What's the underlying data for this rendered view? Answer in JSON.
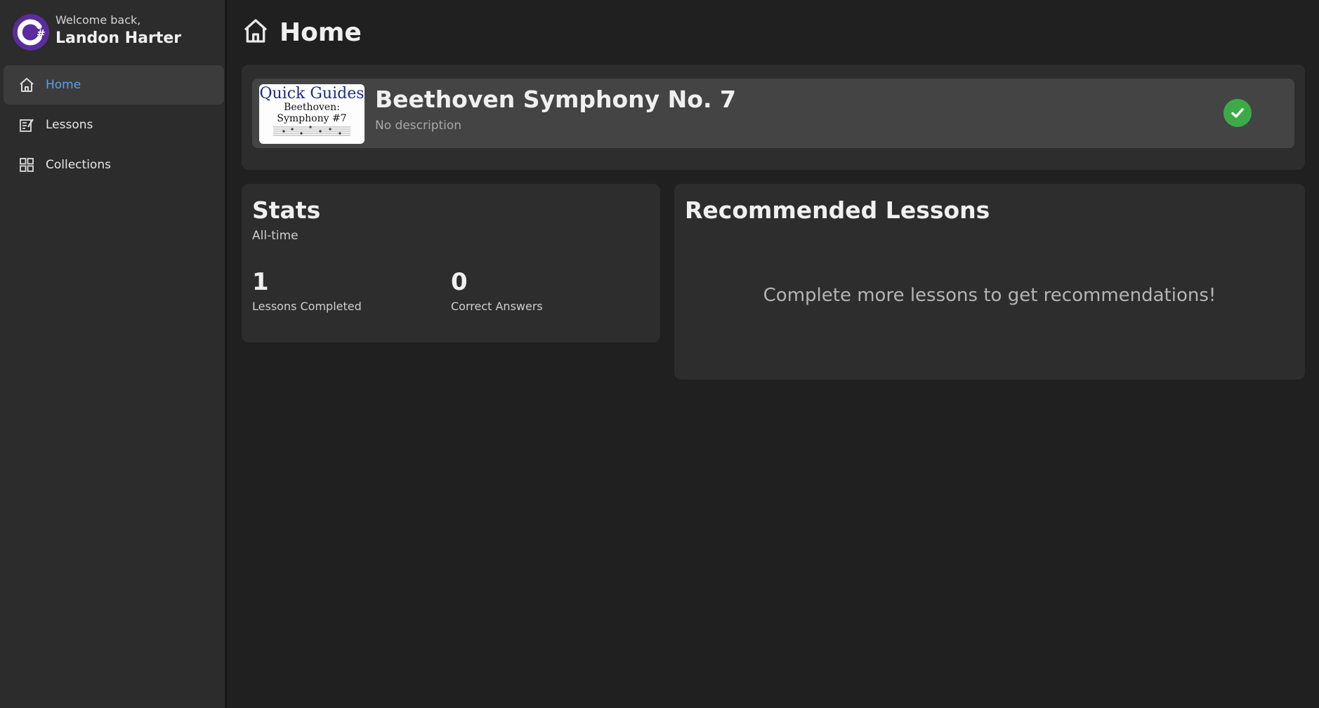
{
  "sidebar": {
    "welcome": "Welcome back,",
    "username": "Landon Harter",
    "items": [
      {
        "label": "Home",
        "icon": "home-icon",
        "active": true
      },
      {
        "label": "Lessons",
        "icon": "lessons-icon",
        "active": false
      },
      {
        "label": "Collections",
        "icon": "grid-icon",
        "active": false
      }
    ]
  },
  "header": {
    "title": "Home"
  },
  "featured": {
    "thumbnail": {
      "line1": "Quick Guides",
      "line2": "Beethoven:",
      "line3": "Symphony #7"
    },
    "title": "Beethoven Symphony No. 7",
    "description": "No description",
    "completed": true
  },
  "stats": {
    "title": "Stats",
    "subtitle": "All-time",
    "items": [
      {
        "value": "1",
        "label": "Lessons Completed"
      },
      {
        "value": "0",
        "label": "Correct Answers"
      }
    ]
  },
  "recommended": {
    "title": "Recommended Lessons",
    "empty_message": "Complete more lessons to get recommendations!"
  },
  "colors": {
    "background": "#202020",
    "sidebar": "#2c2c2c",
    "card": "#2d2d2d",
    "active_nav": "#5aa0f0",
    "success": "#3daa49",
    "logo": "#6a2fb0"
  }
}
